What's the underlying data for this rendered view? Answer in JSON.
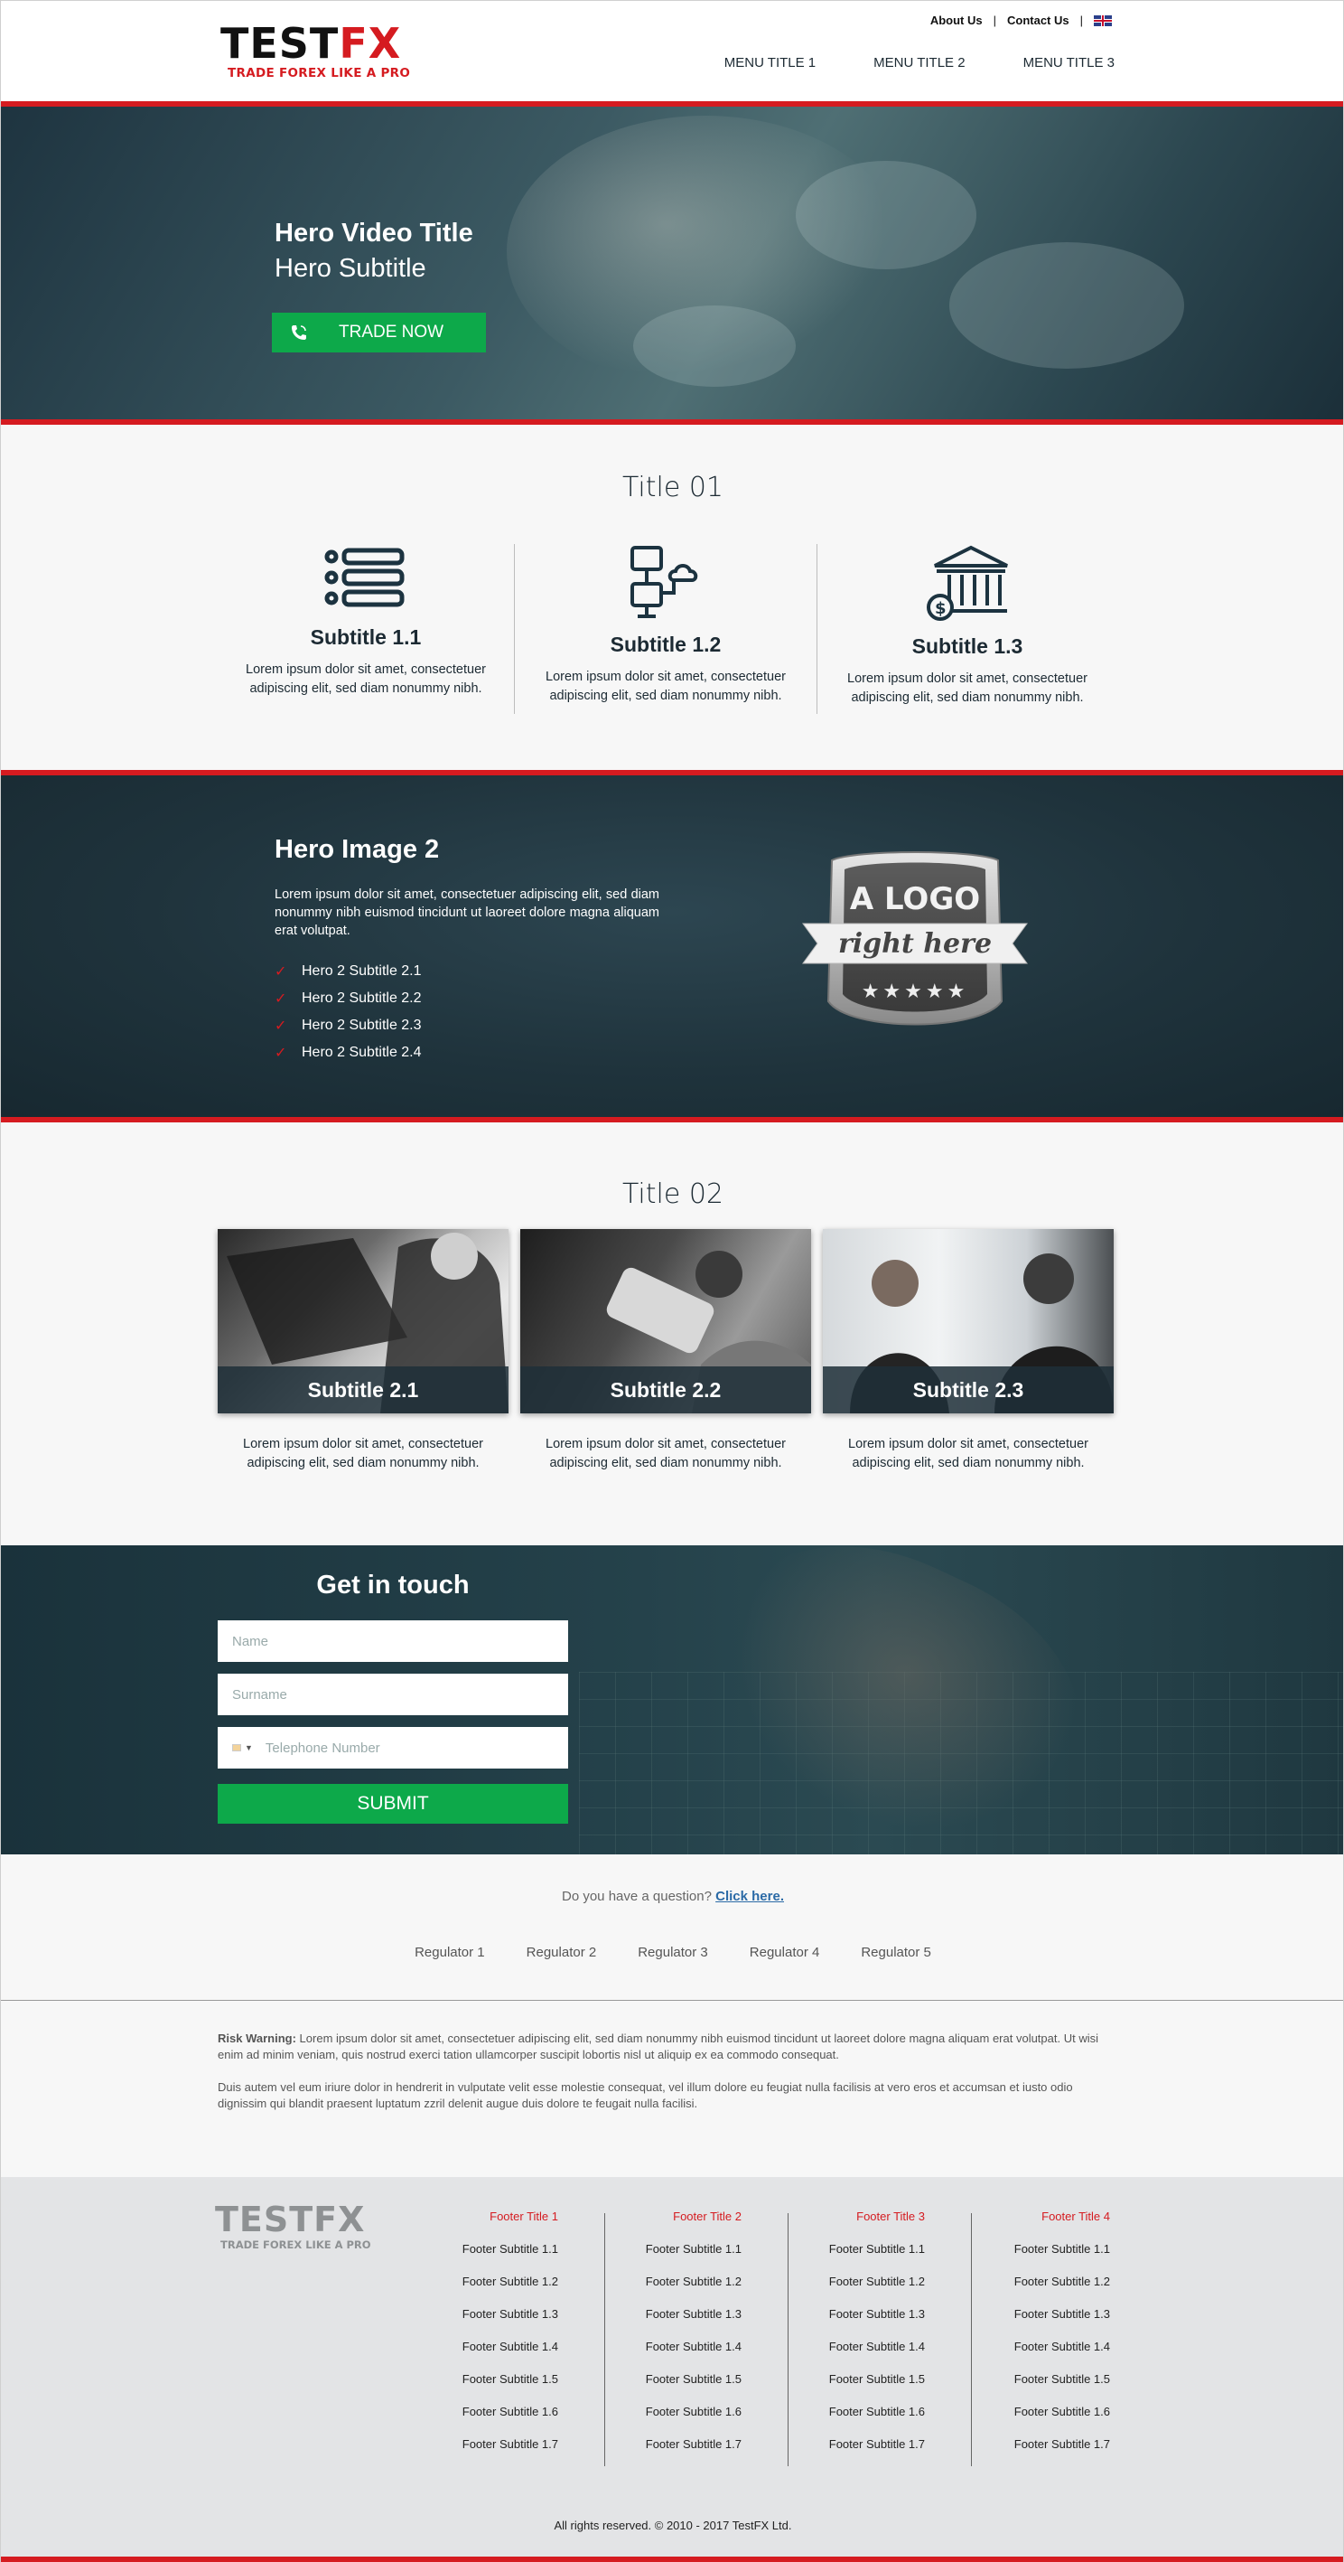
{
  "header": {
    "logo_a": "TEST",
    "logo_b": "FX",
    "tagline": "TRADE FOREX LIKE A PRO",
    "top_links": [
      "About Us",
      "Contact Us"
    ],
    "separator": "|",
    "language_icon": "uk-flag-icon",
    "menu": [
      "MENU TITLE 1",
      "MENU TITLE 2",
      "MENU TITLE 3"
    ]
  },
  "hero": {
    "title": "Hero Video Title",
    "subtitle": "Hero Subtitle",
    "button_label": "TRADE NOW",
    "button_icon": "phone-icon",
    "button_color": "#0da94a"
  },
  "section1": {
    "title": "Title 01",
    "items": [
      {
        "icon": "list-icon",
        "title": "Subtitle 1.1",
        "text": "Lorem ipsum dolor sit amet, consectetuer adipiscing elit, sed diam nonummy nibh."
      },
      {
        "icon": "network-cloud-icon",
        "title": "Subtitle 1.2",
        "text": "Lorem ipsum dolor sit amet, consectetuer adipiscing elit, sed diam nonummy nibh."
      },
      {
        "icon": "bank-icon",
        "title": "Subtitle 1.3",
        "text": "Lorem ipsum dolor sit amet, consectetuer adipiscing elit, sed diam nonummy nibh."
      }
    ]
  },
  "hero2": {
    "title": "Hero Image 2",
    "text": "Lorem ipsum dolor sit amet, consectetuer adipiscing elit, sed diam nonummy nibh euismod tincidunt ut laoreet dolore magna aliquam erat volutpat.",
    "list": [
      "Hero 2 Subtitle 2.1",
      "Hero 2 Subtitle 2.2",
      "Hero 2 Subtitle 2.3",
      "Hero 2 Subtitle 2.4"
    ],
    "badge_top": "A LOGO",
    "badge_ribbon": "right here",
    "badge_stars": "★★★★★"
  },
  "section2": {
    "title": "Title 02",
    "cards": [
      {
        "caption": "Subtitle 2.1",
        "text": "Lorem ipsum dolor sit amet, consectetuer adipiscing elit, sed diam nonummy nibh."
      },
      {
        "caption": "Subtitle 2.2",
        "text": "Lorem ipsum dolor sit amet, consectetuer adipiscing elit, sed diam nonummy nibh."
      },
      {
        "caption": "Subtitle 2.3",
        "text": "Lorem ipsum dolor sit amet, consectetuer adipiscing elit, sed diam nonummy nibh."
      }
    ]
  },
  "contact": {
    "title": "Get in touch",
    "name_placeholder": "Name",
    "surname_placeholder": "Surname",
    "phone_placeholder": "Telephone Number",
    "submit_label": "SUBMIT"
  },
  "question": {
    "text": "Do you have a question?",
    "link": "Click here."
  },
  "regulators": [
    "Regulator 1",
    "Regulator 2",
    "Regulator 3",
    "Regulator 4",
    "Regulator 5"
  ],
  "risk": {
    "label": "Risk Warning:",
    "p1": "Lorem ipsum dolor sit amet, consectetuer adipiscing elit, sed diam nonummy nibh euismod tincidunt ut laoreet dolore magna aliquam erat volutpat. Ut wisi enim ad minim veniam, quis nostrud exerci tation ullamcorper suscipit lobortis nisl ut aliquip ex ea commodo consequat.",
    "p2": "Duis autem vel eum iriure dolor in hendrerit in vulputate velit esse molestie consequat, vel illum dolore eu feugiat nulla facilisis at vero eros et accumsan et iusto odio dignissim qui blandit praesent luptatum zzril delenit augue duis dolore te feugait nulla facilisi."
  },
  "footer": {
    "logo": "TESTFX",
    "tagline": "TRADE FOREX LIKE A PRO",
    "columns": [
      {
        "title": "Footer Title 1",
        "items": [
          "Footer Subtitle 1.1",
          "Footer Subtitle 1.2",
          "Footer Subtitle 1.3",
          "Footer Subtitle 1.4",
          "Footer Subtitle 1.5",
          "Footer Subtitle 1.6",
          "Footer Subtitle 1.7"
        ]
      },
      {
        "title": "Footer Title 2",
        "items": [
          "Footer Subtitle 1.1",
          "Footer Subtitle 1.2",
          "Footer Subtitle 1.3",
          "Footer Subtitle 1.4",
          "Footer Subtitle 1.5",
          "Footer Subtitle 1.6",
          "Footer Subtitle 1.7"
        ]
      },
      {
        "title": "Footer Title 3",
        "items": [
          "Footer Subtitle 1.1",
          "Footer Subtitle 1.2",
          "Footer Subtitle 1.3",
          "Footer Subtitle 1.4",
          "Footer Subtitle 1.5",
          "Footer Subtitle 1.6",
          "Footer Subtitle 1.7"
        ]
      },
      {
        "title": "Footer Title 4",
        "items": [
          "Footer Subtitle 1.1",
          "Footer Subtitle 1.2",
          "Footer Subtitle 1.3",
          "Footer Subtitle 1.4",
          "Footer Subtitle 1.5",
          "Footer Subtitle 1.6",
          "Footer Subtitle 1.7"
        ]
      }
    ],
    "copyright": "All rights reserved. © 2010 - 2017 TestFX Ltd."
  },
  "colors": {
    "brand_red": "#d51b20",
    "dark": "#1c2a33",
    "green": "#0da94a"
  }
}
